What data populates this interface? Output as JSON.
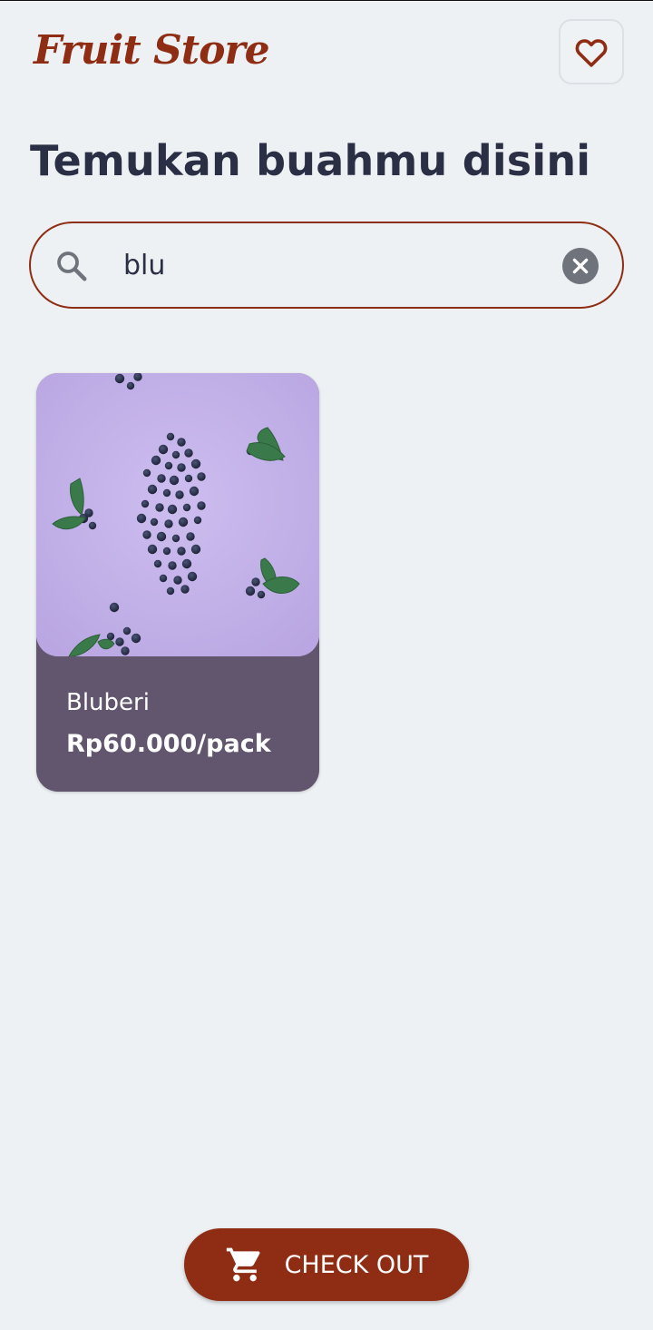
{
  "app": {
    "brand": "Fruit Store",
    "favorite_icon": "heart-outline-icon"
  },
  "main": {
    "heading": "Temukan buahmu disini"
  },
  "search": {
    "value": "blu",
    "placeholder": "",
    "search_icon": "search-icon",
    "clear_icon": "clear-icon"
  },
  "products": [
    {
      "name": "Bluberi",
      "price": "Rp60.000/pack",
      "image": "blueberries-photo"
    }
  ],
  "footer": {
    "checkout_label": "CHECK OUT",
    "checkout_icon": "cart-icon"
  },
  "colors": {
    "accent": "#8f2d14",
    "background": "#edf1f3",
    "card": "#62566f",
    "text": "#2b2f45"
  }
}
